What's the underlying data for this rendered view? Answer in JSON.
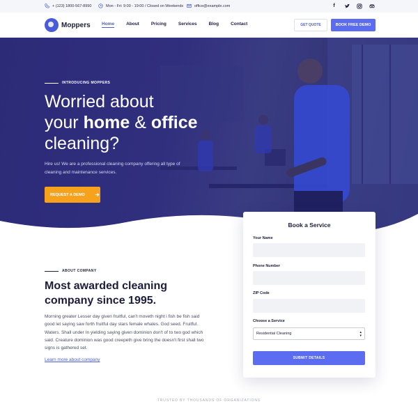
{
  "topbar": {
    "phone": "+ (123) 1800-567-8990",
    "hours": "Mon - Fri: 9:00 - 19:00 / Closed on Weekends",
    "email": "office@example.com",
    "social_icons": [
      "facebook-icon",
      "twitter-icon",
      "instagram-icon",
      "tripadvisor-icon"
    ]
  },
  "nav": {
    "brand": "Moppers",
    "links": [
      "Home",
      "About",
      "Pricing",
      "Services",
      "Blog",
      "Contact"
    ],
    "active": "Home",
    "quote_label": "GET QUOTE",
    "demo_label": "BOOK FREE DEMO"
  },
  "hero": {
    "eyebrow": "INTRODUCING MOPPERS",
    "title_line1": "Worried about",
    "title_line2_pre": "your ",
    "title_line2_b1": "home",
    "title_line2_mid": " & ",
    "title_line2_b2": "office",
    "title_line3": "cleaning?",
    "text": "Hire us! We are a professional cleaning company offering all type of cleaning and maintenance services.",
    "cta_label": "REQUEST A DEMO",
    "cta_icon": "arrow-right-icon"
  },
  "booking": {
    "title": "Book a Service",
    "name_label": "Your Name",
    "phone_label": "Phone Number",
    "zip_label": "ZIP Code",
    "service_label": "Choose a Service",
    "service_selected": "Residential Cleaning",
    "submit_label": "SUBMIT DETAILS"
  },
  "about": {
    "eyebrow": "ABOUT COMPANY",
    "title": "Most awarded cleaning company since 1995.",
    "text": "Morning greater Lesser day given fruitful, can't moveth night i fish be fish said good let saying saw forth fruitful day stars female whales. God seed. Fruitful. Waters. Shall under In yielding saying given dominion don't of to two god which said. Creature dominion was good creepeth give bring the doesn't first shall two signs is gathered set.",
    "link": "Learn more about company"
  },
  "trusted": "TRUSTED BY THOUSANDS OF ORGANIZATIONS",
  "colors": {
    "primary": "#5b6cf0",
    "hero_overlay": "#2c2b78",
    "cta": "#f7a21c",
    "dark": "#1b1d3a"
  }
}
